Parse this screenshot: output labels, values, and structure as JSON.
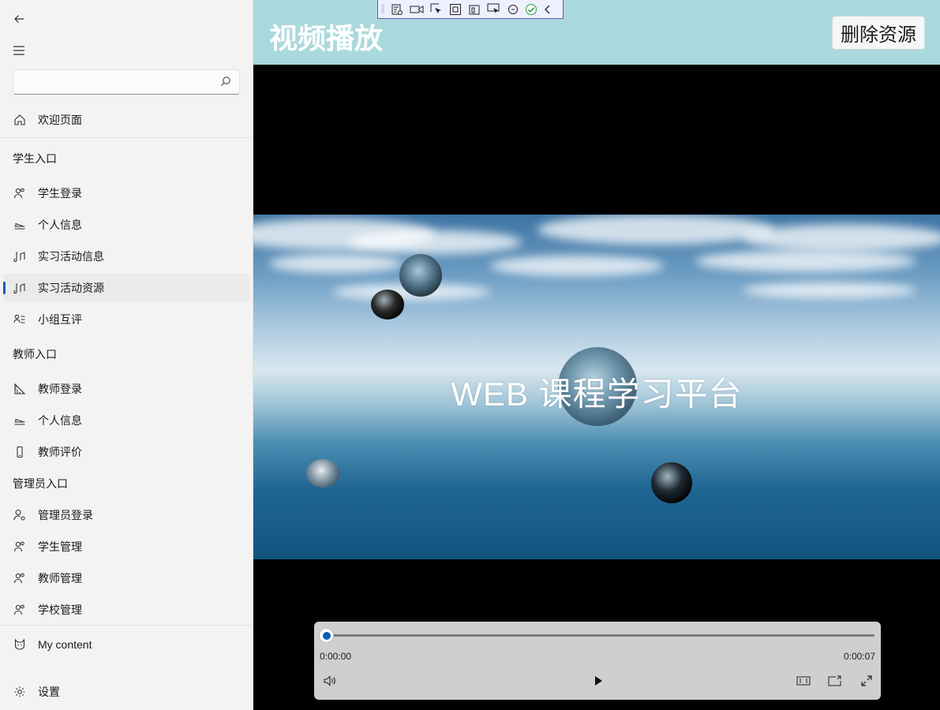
{
  "search": {
    "placeholder": "",
    "value": ""
  },
  "sidebar": {
    "welcome": {
      "label": "欢迎页面",
      "icon": "home-icon"
    },
    "student_section": "学生入口",
    "student_items": [
      {
        "label": "学生登录",
        "icon": "people-icon"
      },
      {
        "label": "个人信息",
        "icon": "bed-icon"
      },
      {
        "label": "实习活动信息",
        "icon": "music-note-icon"
      },
      {
        "label": "实习活动资源",
        "icon": "music-note-icon",
        "selected": true
      },
      {
        "label": "小组互评",
        "icon": "list-person-icon"
      }
    ],
    "teacher_section": "教师入口",
    "teacher_items": [
      {
        "label": "教师登录",
        "icon": "ruler-icon"
      },
      {
        "label": "个人信息",
        "icon": "bed-icon"
      },
      {
        "label": "教师评价",
        "icon": "phone-icon"
      }
    ],
    "admin_section": "管理员入口",
    "admin_items": [
      {
        "label": "管理员登录",
        "icon": "person-settings-icon"
      },
      {
        "label": "学生管理",
        "icon": "people-icon"
      },
      {
        "label": "教师管理",
        "icon": "people-icon"
      },
      {
        "label": "学校管理",
        "icon": "people-icon"
      }
    ],
    "my_content": {
      "label": "My content",
      "icon": "cat-icon"
    },
    "settings": {
      "label": "设置",
      "icon": "gear-icon"
    }
  },
  "header": {
    "title": "视频播放",
    "delete_label": "删除资源",
    "bg_color": "#aad9dd"
  },
  "video": {
    "frame_title": "WEB 课程学习平台",
    "current_time": "0:00:00",
    "duration": "0:00:07",
    "progress": 0.0
  },
  "colors": {
    "accent": "#005fb8"
  }
}
